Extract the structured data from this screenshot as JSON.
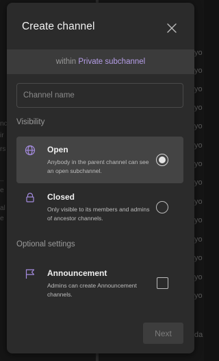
{
  "dialog": {
    "title": "Create channel",
    "close_icon": "close-icon"
  },
  "context": {
    "prefix": "within",
    "parent_name": "Private subchannel",
    "accent_color": "#b69ee8"
  },
  "channel_name_input": {
    "placeholder": "Channel name",
    "value": ""
  },
  "visibility": {
    "label": "Visibility",
    "options": [
      {
        "title": "Open",
        "description": "Anybody in the parent channel can see an open subchannel.",
        "icon": "globe-icon",
        "selected": true
      },
      {
        "title": "Closed",
        "description": "Only visible to its members and admins of ancestor channels.",
        "icon": "lock-icon",
        "selected": false
      }
    ]
  },
  "optional_settings": {
    "label": "Optional settings",
    "announcement": {
      "title": "Announcement",
      "description": "Admins can create Announcement channels.",
      "icon": "flag-icon",
      "checked": false
    }
  },
  "footer": {
    "next_label": "Next",
    "next_enabled": false
  },
  "background_fragments": {
    "right_column": [
      "yo",
      "yo",
      "yo",
      "yo",
      "yo",
      "yo",
      "yo",
      "yo",
      "yo",
      "yo",
      "yo",
      "yo",
      "yo",
      "yo",
      "da"
    ],
    "left_column": [
      "nc",
      "ir",
      "rs",
      "..",
      "e",
      "al",
      "e"
    ]
  }
}
